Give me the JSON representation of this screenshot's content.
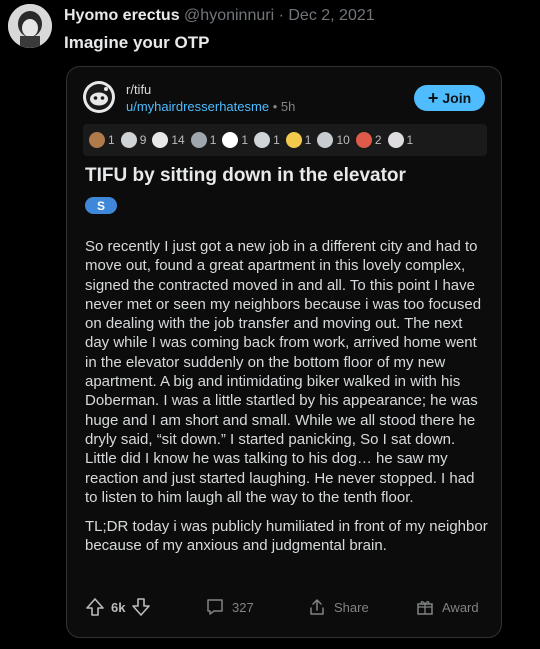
{
  "tweet": {
    "author_name": "Hyomo erectus",
    "author_handle": "@hyoninnuri",
    "separator": "·",
    "date": "Dec 2, 2021",
    "text": "Imagine your OTP"
  },
  "post": {
    "subreddit": "r/tifu",
    "user": "u/myhairdresserhatesme",
    "separator": "•",
    "age": "5h",
    "join_label": "Join",
    "awards": [
      {
        "icon": "award-icon",
        "count": "1",
        "color": "#b07a4a"
      },
      {
        "icon": "award-icon",
        "count": "9",
        "color": "#cfd3d6"
      },
      {
        "icon": "award-icon",
        "count": "14",
        "color": "#e8e8e8"
      },
      {
        "icon": "award-icon",
        "count": "1",
        "color": "#9ea7ad"
      },
      {
        "icon": "award-icon",
        "count": "1",
        "color": "#ffffff"
      },
      {
        "icon": "award-icon",
        "count": "1",
        "color": "#d0d4d8"
      },
      {
        "icon": "award-icon",
        "count": "1",
        "color": "#f2c94c"
      },
      {
        "icon": "award-icon",
        "count": "10",
        "color": "#c8ccd0"
      },
      {
        "icon": "award-icon",
        "count": "2",
        "color": "#e05a4a"
      },
      {
        "icon": "award-icon",
        "count": "1",
        "color": "#e0dde0"
      }
    ],
    "title": "TIFU by sitting down in the elevator",
    "flair": "S",
    "body": [
      "So recently I just got a new job in a different city and had to move out, found a great apartment in this lovely complex, signed the contracted moved in and all. To this point I have never met or seen my neighbors because i was too focused on dealing with the job transfer and moving out. The next day while I was coming back from work, arrived home went in the elevator suddenly on the bottom floor of my new apartment. A big and intimidating biker walked in with his Doberman. I was a little startled by his appearance; he was huge and I am short and small. While we all stood there he dryly said, “sit down.” I started panicking, So I sat down. Little did I know he was talking to his dog… he saw my reaction and just started laughing. He never stopped. I had to listen to him laugh all the way to the tenth floor.",
      "TL;DR today i was publicly humiliated in front of my neighbor because of my anxious and judgmental brain."
    ],
    "votes": "6k",
    "comments": "327",
    "share_label": "Share",
    "award_label": "Award",
    "colors": {
      "accent": "#4fbcff",
      "flair": "#3f88d9"
    }
  }
}
